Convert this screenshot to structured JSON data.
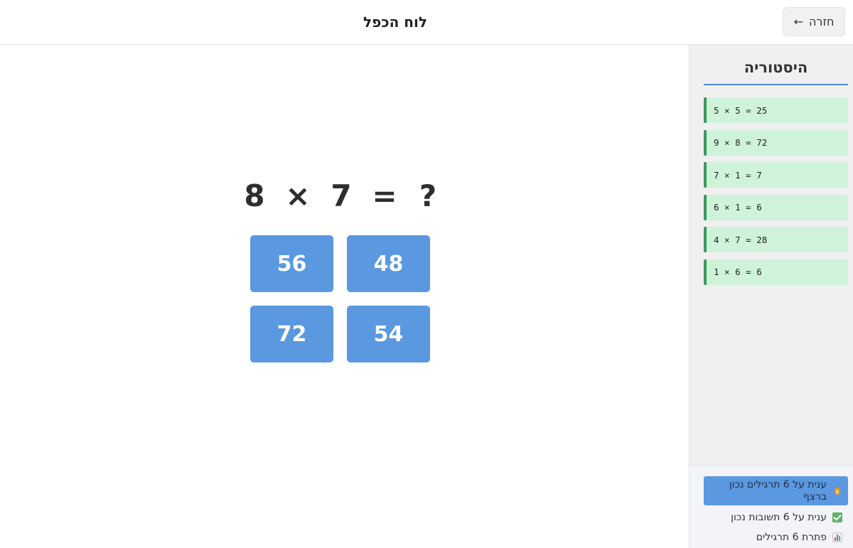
{
  "header": {
    "title": "לוח הכפל",
    "back_label": "חזרה",
    "back_arrow": "←"
  },
  "question": {
    "operand_a": "8",
    "operator": "×",
    "operand_b": "7",
    "equals": "=",
    "unknown": "?"
  },
  "answers": [
    "56",
    "48",
    "72",
    "54"
  ],
  "history": {
    "title": "היסטוריה",
    "items": [
      "5 × 5 = 25",
      "9 × 8 = 72",
      "7 × 1 = 7",
      "6 × 1 = 6",
      "4 × 7 = 28",
      "1 × 6 = 6"
    ],
    "item_color": "#cff3d9",
    "item_border_color": "#3c9a5c"
  },
  "stats": [
    {
      "icon": "fire-icon",
      "text": "ענית על 6 תרגילים נכון ברצף"
    },
    {
      "icon": "check-icon",
      "text": "ענית על 6 תשובות נכון"
    },
    {
      "icon": "bar-chart-icon",
      "text": "פתרת 6 תרגילים"
    }
  ],
  "colors": {
    "accent": "#5a98e0",
    "title_underline": "#4a88d8"
  }
}
